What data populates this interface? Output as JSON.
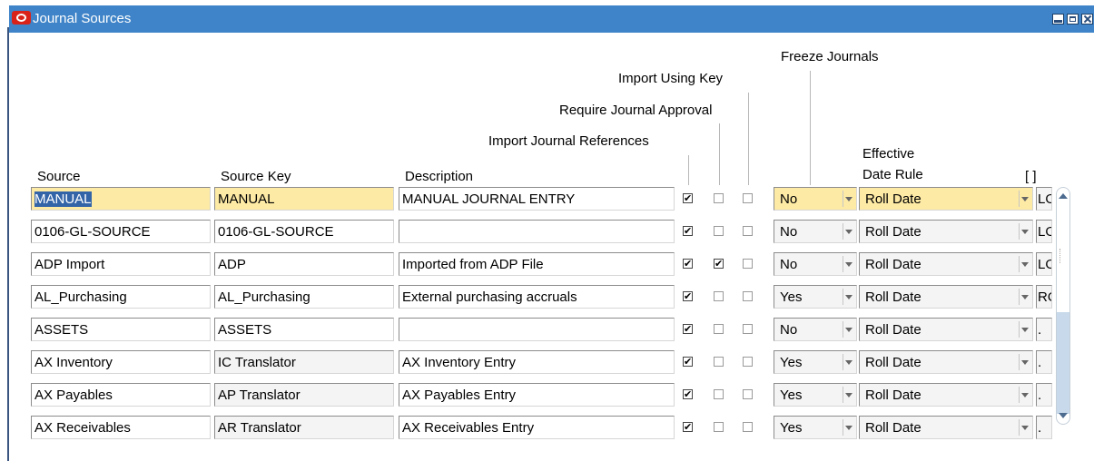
{
  "window": {
    "title": "Journal Sources"
  },
  "headers": {
    "source": "Source",
    "source_key": "Source Key",
    "description": "Description",
    "import_journal_references": "Import Journal References",
    "require_journal_approval": "Require Journal Approval",
    "import_using_key": "Import Using Key",
    "freeze_journals": "Freeze Journals",
    "effective_date_rule_line1": "Effective",
    "effective_date_rule_line2": "Date Rule",
    "flex_field": "[ ]"
  },
  "rows": [
    {
      "source": "MANUAL",
      "key": "MANUAL",
      "description": "MANUAL JOURNAL ENTRY",
      "import_refs": true,
      "require_approval": false,
      "import_using_key": false,
      "freeze": "No",
      "date_rule": "Roll Date",
      "extra": "LO",
      "current": true
    },
    {
      "source": "0106-GL-SOURCE",
      "key": "0106-GL-SOURCE",
      "description": "",
      "import_refs": true,
      "require_approval": false,
      "import_using_key": false,
      "freeze": "No",
      "date_rule": "Roll Date",
      "extra": "LO"
    },
    {
      "source": "ADP Import",
      "key": "ADP",
      "description": "Imported from ADP File",
      "import_refs": true,
      "require_approval": true,
      "import_using_key": false,
      "freeze": "No",
      "date_rule": "Roll Date",
      "extra": "LO"
    },
    {
      "source": "AL_Purchasing",
      "key": "AL_Purchasing",
      "description": "External purchasing accruals",
      "import_refs": true,
      "require_approval": false,
      "import_using_key": false,
      "freeze": "Yes",
      "date_rule": "Roll Date",
      "extra": "RO"
    },
    {
      "source": "ASSETS",
      "key": "ASSETS",
      "description": "",
      "import_refs": true,
      "require_approval": false,
      "import_using_key": false,
      "freeze": "No",
      "date_rule": "Roll Date",
      "extra": "."
    },
    {
      "source": "AX Inventory",
      "key": "IC Translator",
      "description": "AX Inventory Entry",
      "import_refs": true,
      "require_approval": false,
      "import_using_key": false,
      "freeze": "Yes",
      "date_rule": "Roll Date",
      "extra": "."
    },
    {
      "source": "AX Payables",
      "key": "AP Translator",
      "description": "AX Payables Entry",
      "import_refs": true,
      "require_approval": false,
      "import_using_key": false,
      "freeze": "Yes",
      "date_rule": "Roll Date",
      "extra": "."
    },
    {
      "source": "AX Receivables",
      "key": "AR Translator",
      "description": "AX Receivables Entry",
      "import_refs": true,
      "require_approval": false,
      "import_using_key": false,
      "freeze": "Yes",
      "date_rule": "Roll Date",
      "extra": "."
    }
  ],
  "icons": {
    "app": "oracle-logo-icon",
    "minimize": "minimize-icon",
    "maximize": "maximize-icon",
    "close": "close-icon"
  },
  "colors": {
    "titlebar": "#3f84c8",
    "current_record": "#fdeaa5",
    "selection": "#3464a8"
  }
}
